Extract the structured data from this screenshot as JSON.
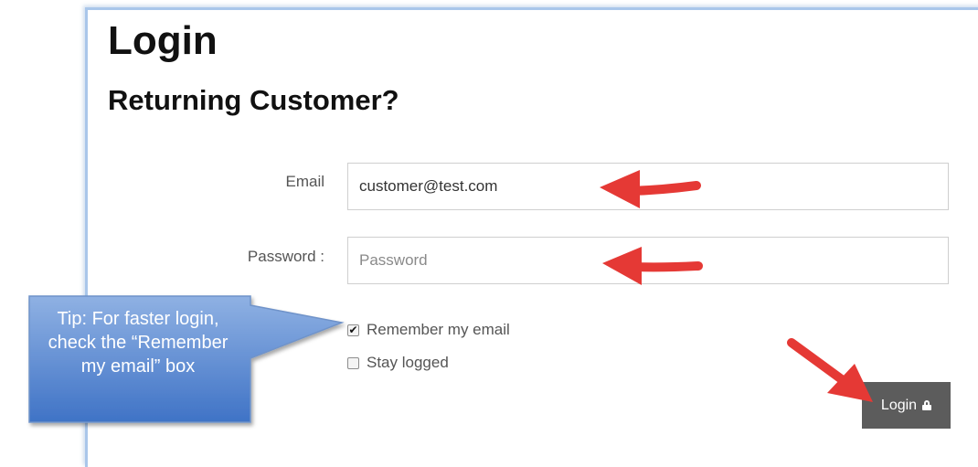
{
  "header": {
    "title": "Login",
    "subtitle": "Returning Customer?"
  },
  "form": {
    "email_label": "Email",
    "email_value": "customer@test.com",
    "password_label": "Password :",
    "password_placeholder": "Password",
    "remember_label": "Remember my email",
    "remember_checked": true,
    "stay_label": "Stay logged",
    "stay_checked": false,
    "login_label": "Login"
  },
  "callout": {
    "text": "Tip: For faster login, check the “Remember my email” box"
  },
  "colors": {
    "arrow": "#e53935",
    "callout_top": "#8fb1e3",
    "callout_bottom": "#3f73c6",
    "button": "#5c5c5c"
  },
  "icons": {
    "login_button_icon": "lock-icon",
    "annotation_arrows": "red-arrow-icon"
  }
}
